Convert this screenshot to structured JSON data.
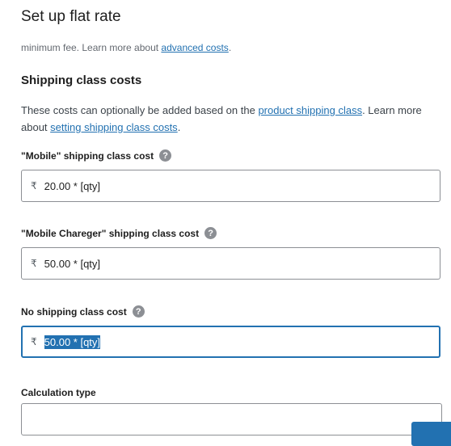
{
  "modal": {
    "title": "Set up flat rate"
  },
  "intro": {
    "text": "minimum fee. Learn more about ",
    "link": "advanced costs",
    "end": "."
  },
  "shipping_class_costs": {
    "heading": "Shipping class costs",
    "desc_part1": "These costs can optionally be added based on the ",
    "desc_link1": "product shipping class",
    "desc_part2": ". Learn more about ",
    "desc_link2": "setting shipping class costs",
    "desc_end": "."
  },
  "fields": [
    {
      "label": "\"Mobile\" shipping class cost",
      "currency": "₹",
      "value": "20.00 * [qty]"
    },
    {
      "label": "\"Mobile Chareger\" shipping class cost",
      "currency": "₹",
      "value": "50.00 * [qty]"
    },
    {
      "label": "No shipping class cost",
      "currency": "₹",
      "value": "50.00 * [qty]"
    }
  ],
  "help_glyph": "?",
  "calculation_type": {
    "label": "Calculation type"
  },
  "colors": {
    "accent": "#2271b1",
    "border": "#8c8f94",
    "help_icon": "#8c8f94"
  }
}
